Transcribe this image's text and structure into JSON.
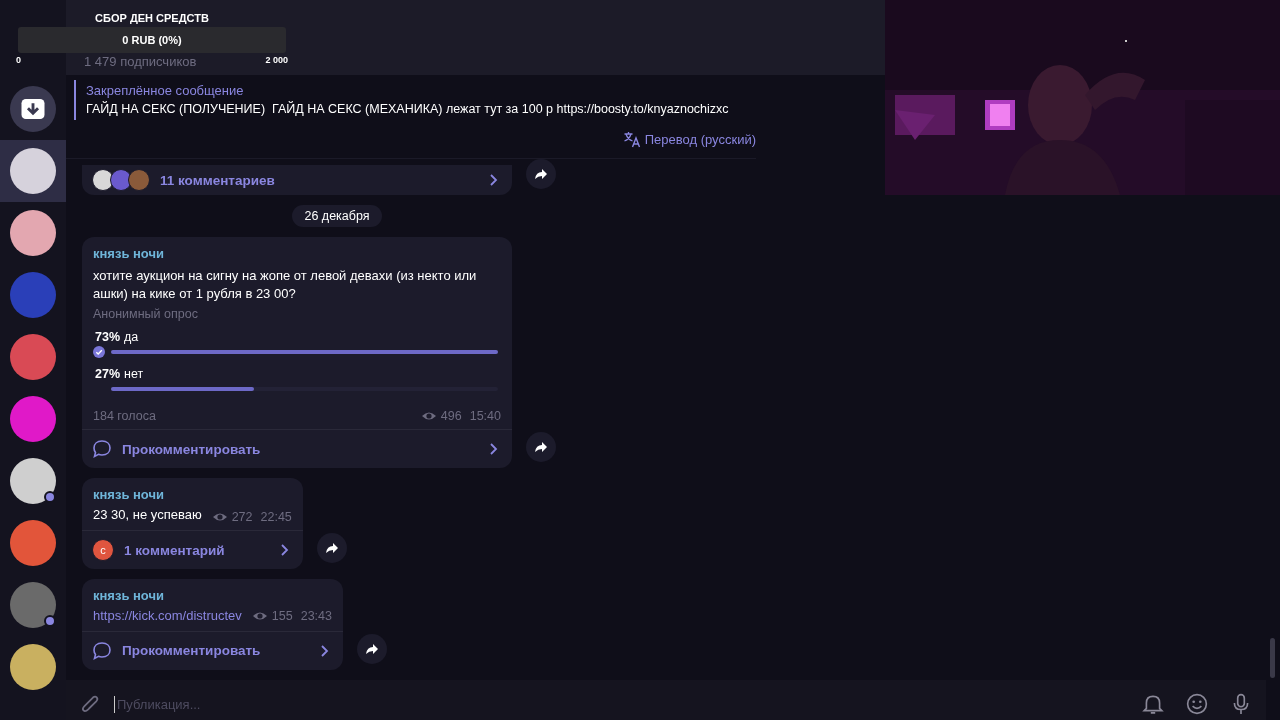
{
  "donation": {
    "title": "СБОР ДЕН СРЕДСТВ",
    "amount": "0 RUB (0%)",
    "level": 0,
    "min": "0",
    "max": "2 000"
  },
  "channel": {
    "subscribers": "1 479 подписчиков"
  },
  "sidebar": {
    "items": [
      {
        "kind": "archive",
        "selected": false
      },
      {
        "kind": "avatar",
        "color": "#d6d2dc",
        "selected": true,
        "online": false
      },
      {
        "kind": "avatar",
        "color": "#e3a7b0",
        "selected": false,
        "online": false
      },
      {
        "kind": "avatar",
        "color": "#2a3fb8",
        "selected": false,
        "online": false
      },
      {
        "kind": "avatar",
        "color": "#d94a55",
        "selected": false,
        "online": false
      },
      {
        "kind": "avatar",
        "color": "#e019c8",
        "selected": false,
        "online": false
      },
      {
        "kind": "avatar",
        "color": "#cfcfcf",
        "selected": false,
        "online": true
      },
      {
        "kind": "avatar",
        "color": "#e2553a",
        "selected": false,
        "online": false
      },
      {
        "kind": "avatar",
        "color": "#6a6a6a",
        "selected": false,
        "online": true
      },
      {
        "kind": "avatar",
        "color": "#c9b060",
        "selected": false,
        "online": false
      }
    ]
  },
  "pinned": {
    "title": "Закреплённое сообщение",
    "text": "ГАЙД НА СЕКС (ПОЛУЧЕНИЕ)  ГАЙД НА СЕКС (МЕХАНИКА) лежат тут за 100 р https://boosty.to/knyaznochizxc"
  },
  "translate": "Перевод (русский)",
  "messages": [
    {
      "kind": "footer-only",
      "footer": {
        "kind": "comments",
        "label": "11 комментариев",
        "commenters": [
          {
            "color": "#d8d8d8"
          },
          {
            "color": "#6a5acd"
          },
          {
            "color": "#8a5a3a"
          }
        ]
      }
    },
    {
      "kind": "date",
      "label": "26 декабря"
    },
    {
      "kind": "poll",
      "author": "князь ночи",
      "question": "хотите аукцион на сигну на жопе от левой девахи (из некто или ашки) на кике от 1 рубля в 23 00?",
      "poll_type": "Анонимный опрос",
      "options": [
        {
          "percent": "73%",
          "label": "да",
          "level": 1,
          "chosen": true
        },
        {
          "percent": "27%",
          "label": "нет",
          "level": 0.37,
          "chosen": false
        }
      ],
      "votes": "184 голоса",
      "views": "496",
      "time": "15:40",
      "footer": {
        "kind": "comment",
        "label": "Прокомментировать"
      }
    },
    {
      "kind": "text",
      "author": "князь ночи",
      "text": "23 30, не успеваю",
      "views": "272",
      "time": "22:45",
      "footer": {
        "kind": "comments",
        "label": "1 комментарий",
        "commenters": [
          {
            "initial": "с",
            "color": "#e0553f"
          }
        ]
      }
    },
    {
      "kind": "link",
      "author": "князь ночи",
      "text": "https://kick.com/distructev",
      "views": "155",
      "time": "23:43",
      "footer": {
        "kind": "comment",
        "label": "Прокомментировать"
      }
    }
  ],
  "composer": {
    "placeholder": "Публикация..."
  }
}
